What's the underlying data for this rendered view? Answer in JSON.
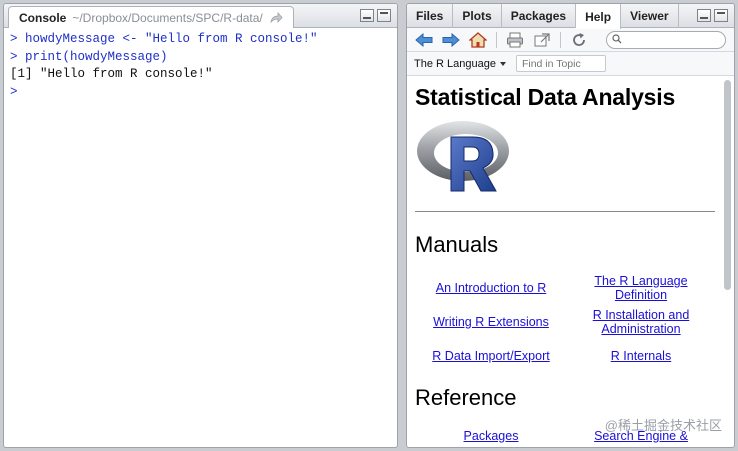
{
  "console": {
    "tab_title": "Console",
    "path": "~/Dropbox/Documents/SPC/R-data/",
    "lines": [
      {
        "kind": "cmd",
        "text": "> howdyMessage <- \"Hello from R console!\""
      },
      {
        "kind": "cmd",
        "text": "> print(howdyMessage)"
      },
      {
        "kind": "out",
        "text": "[1] \"Hello from R console!\""
      },
      {
        "kind": "cmd",
        "text": ">"
      }
    ]
  },
  "help_pane": {
    "tabs": [
      "Files",
      "Plots",
      "Packages",
      "Help",
      "Viewer"
    ],
    "active_tab": "Help",
    "topic_select": "The R Language",
    "find_placeholder": "Find in Topic",
    "search_placeholder": ""
  },
  "doc": {
    "title": "Statistical Data Analysis",
    "manuals_heading": "Manuals",
    "manuals": [
      "An Introduction to R",
      "The R Language Definition",
      "Writing R Extensions",
      "R Installation and Administration",
      "R Data Import/Export",
      "R Internals"
    ],
    "reference_heading": "Reference",
    "reference_links": [
      "Packages",
      "Search Engine &"
    ]
  },
  "watermark": "@稀土掘金技术社区",
  "colors": {
    "link": "#1a0fd6",
    "console_cmd": "#1f30c9"
  }
}
